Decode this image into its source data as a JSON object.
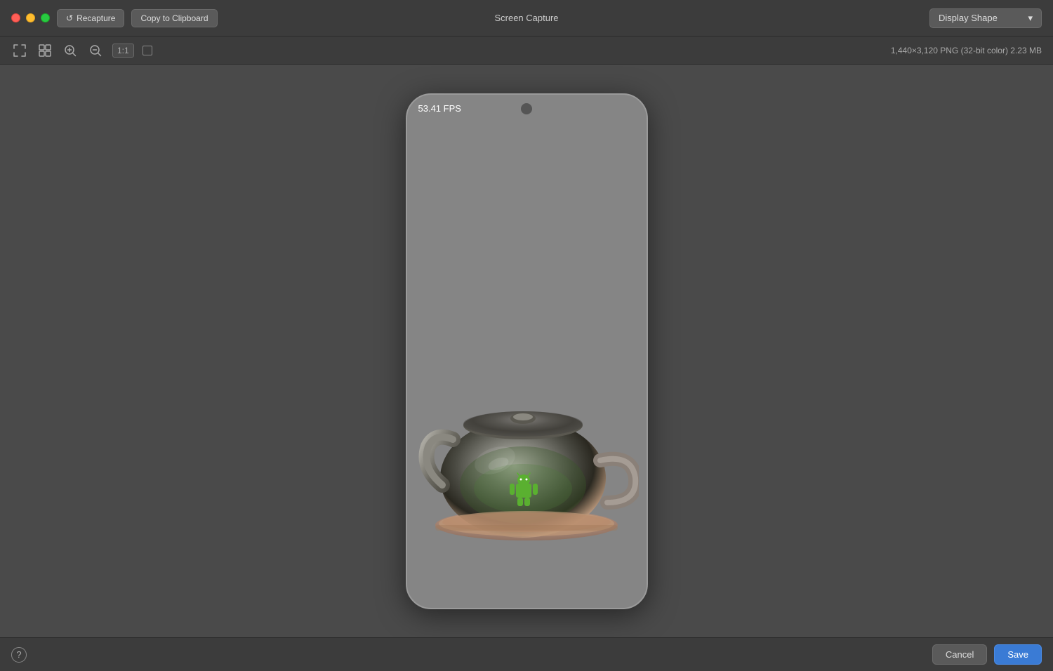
{
  "window": {
    "title": "Screen Capture"
  },
  "toolbar": {
    "recapture_label": "Recapture",
    "copy_label": "Copy to Clipboard",
    "zoom_label": "1:1",
    "display_shape_label": "Display Shape",
    "file_info": "1,440×3,120 PNG (32-bit color) 2.23 MB",
    "fps_label": "53.41 FPS"
  },
  "bottom": {
    "cancel_label": "Cancel",
    "save_label": "Save",
    "help_label": "?"
  },
  "icons": {
    "fullscreen": "⤢",
    "grid": "⊞",
    "zoom_in": "⊕",
    "zoom_out": "⊖",
    "checkbox": ""
  }
}
